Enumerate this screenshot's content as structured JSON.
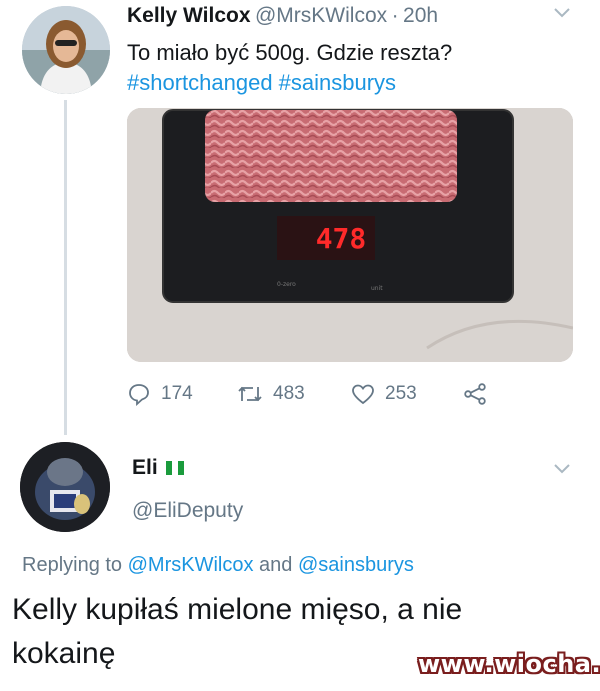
{
  "tweet": {
    "author_name": "Kelly Wilcox",
    "author_handle": "@MrsKWilcox",
    "separator": "·",
    "time": "20h",
    "text": "To miało być 500g. Gdzie reszta?",
    "hashtags": "#shortchanged #sainsburys",
    "scale_display": "478",
    "scale_label_left": "0-zero",
    "scale_label_right": "unit",
    "reply_count": "174",
    "retweet_count": "483",
    "like_count": "253",
    "icons": [
      "reply-icon",
      "retweet-icon",
      "like-icon",
      "share-icon",
      "chevron-down-icon"
    ]
  },
  "reply": {
    "author_name": "Eli",
    "author_handle": "@EliDeputy",
    "flag_colors": [
      "#1a9b3c",
      "#ffffff",
      "#1a9b3c"
    ],
    "replying_prefix": "Replying to",
    "replying_user1": "@MrsKWilcox",
    "replying_and": "and",
    "replying_user2": "@sainsburys"
  },
  "caption": {
    "line1": "Kelly kupiłaś mielone mięso, a nie",
    "line2": "kokainę"
  },
  "watermark": "www.wiocha.pl",
  "colors": {
    "link": "#1b95e0",
    "secondary": "#657786",
    "thread_line": "#d6dde3"
  }
}
